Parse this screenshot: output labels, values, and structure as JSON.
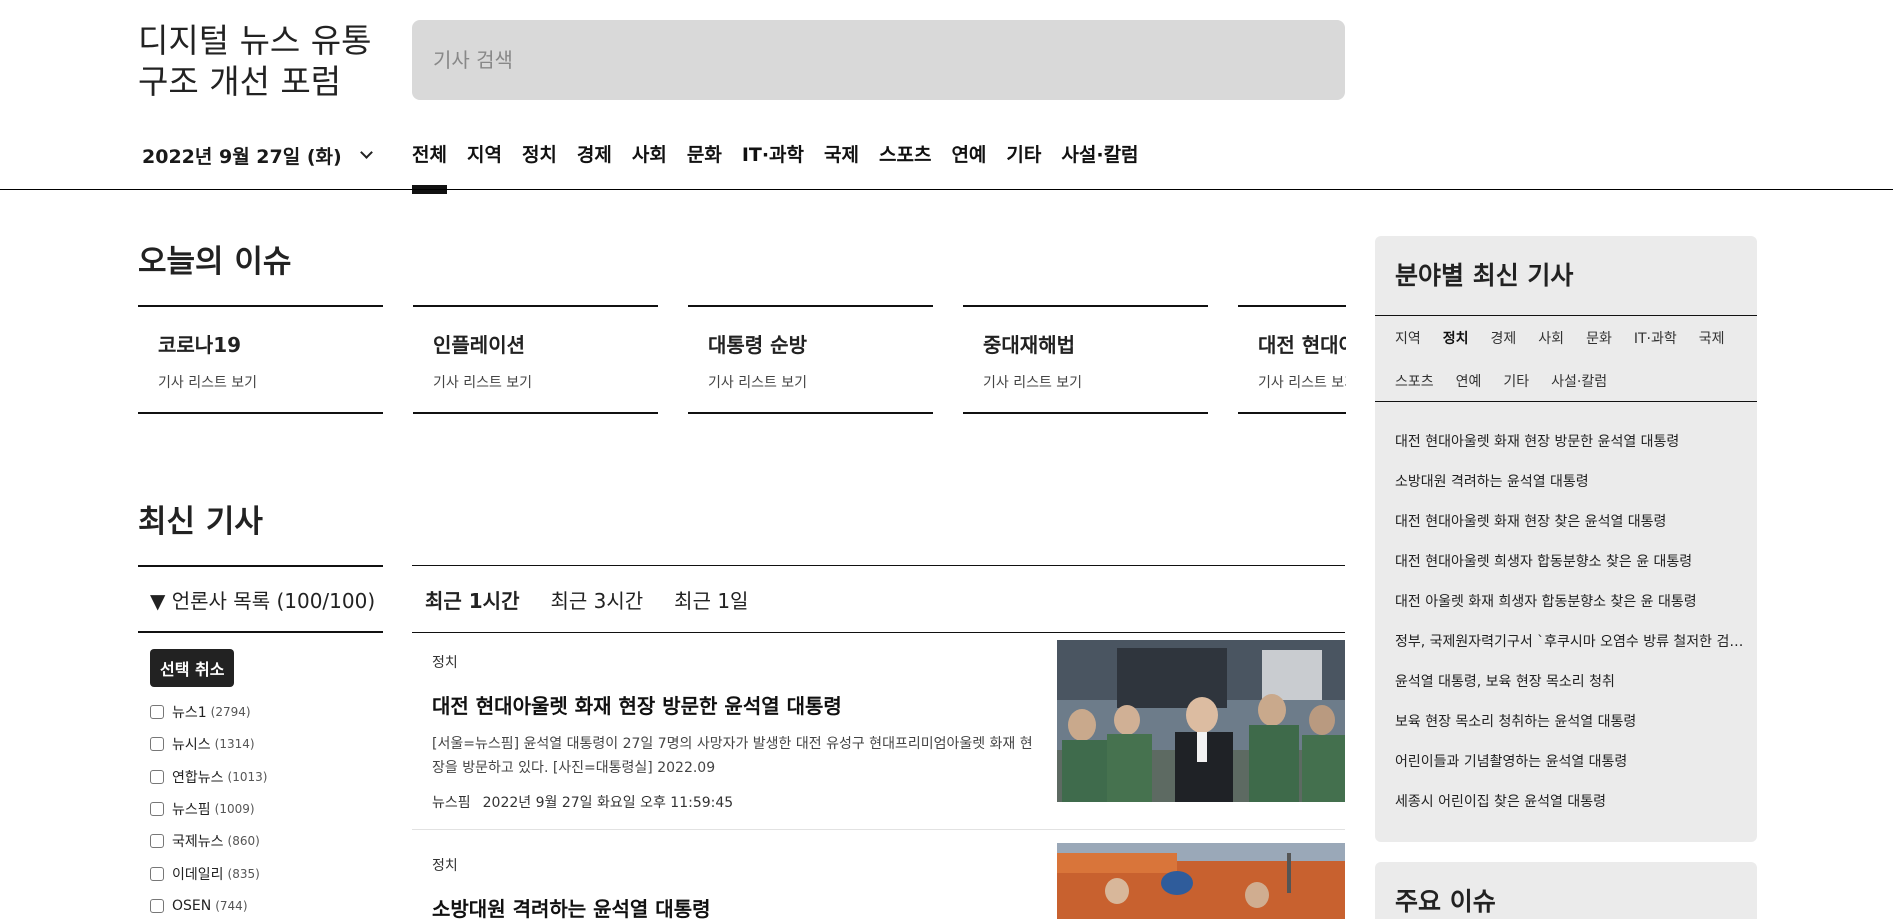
{
  "header": {
    "site_title_line1": "디지털 뉴스 유통",
    "site_title_line2": "구조 개선 포럼",
    "search_placeholder": "기사 검색",
    "date_label": "2022년 9월 27일 (화)"
  },
  "nav": {
    "items": [
      "전체",
      "지역",
      "정치",
      "경제",
      "사회",
      "문화",
      "IT·과학",
      "국제",
      "스포츠",
      "연예",
      "기타",
      "사설·칼럼"
    ],
    "active": "전체"
  },
  "today_issues": {
    "title": "오늘의 이슈",
    "cards": [
      {
        "title": "코로나19",
        "sub": "기사 리스트 보기"
      },
      {
        "title": "인플레이션",
        "sub": "기사 리스트 보기"
      },
      {
        "title": "대통령 순방",
        "sub": "기사 리스트 보기"
      },
      {
        "title": "중대재해법",
        "sub": "기사 리스트 보기"
      },
      {
        "title": "대전 현대아",
        "sub": "기사 리스트 보기"
      }
    ]
  },
  "latest": {
    "title": "최신 기사",
    "press_header": "▼ 언론사 목록 (100/100)",
    "deselect_label": "선택 취소",
    "press_list": [
      {
        "name": "뉴스1",
        "count": "(2794)"
      },
      {
        "name": "뉴시스",
        "count": "(1314)"
      },
      {
        "name": "연합뉴스",
        "count": "(1013)"
      },
      {
        "name": "뉴스핌",
        "count": "(1009)"
      },
      {
        "name": "국제뉴스",
        "count": "(860)"
      },
      {
        "name": "이데일리",
        "count": "(835)"
      },
      {
        "name": "OSEN",
        "count": "(744)"
      }
    ],
    "time_tabs": [
      "최근 1시간",
      "최근 3시간",
      "최근 1일"
    ],
    "active_tab": "최근 1시간",
    "articles": [
      {
        "category": "정치",
        "title": "대전 현대아울렛 화재 현장 방문한 윤석열 대통령",
        "excerpt": "[서울=뉴스핌] 윤석열 대통령이 27일 7명의 사망자가 발생한 대전 유성구 현대프리미엄아울렛 화재 현장을 방문하고 있다. [사진=대통령실] 2022.09",
        "source": "뉴스핌",
        "time": "2022년 9월 27일 화요일 오후 11:59:45"
      },
      {
        "category": "정치",
        "title": "소방대원 격려하는 윤석열 대통령"
      }
    ]
  },
  "sidebar": {
    "title": "분야별 최신 기사",
    "tabs": [
      "지역",
      "정치",
      "경제",
      "사회",
      "문화",
      "IT·과학",
      "국제",
      "스포츠",
      "연예",
      "기타",
      "사설·칼럼"
    ],
    "active_tab": "정치",
    "headlines": [
      "대전 현대아울렛 화재 현장 방문한 윤석열 대통령",
      "소방대원 격려하는 윤석열 대통령",
      "대전 현대아울렛 화재 현장 찾은 윤석열 대통령",
      "대전 현대아울렛 희생자 합동분향소 찾은 윤 대통령",
      "대전 아울렛 화재 희생자 합동분향소 찾은 윤 대통령",
      "정부, 국제원자력기구서 `후쿠시마 오염수 방류 철저한 검증`",
      "윤석열 대통령, 보육 현장 목소리 청취",
      "보육 현장 목소리 청취하는 윤석열 대통령",
      "어린이들과 기념촬영하는 윤석열 대통령",
      "세종시 어린이집 찾은 윤석열 대통령"
    ],
    "major_title": "주요 이슈"
  }
}
